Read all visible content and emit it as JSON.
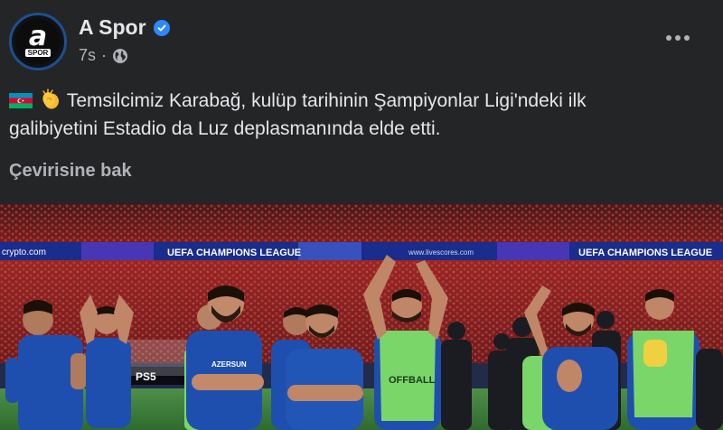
{
  "post": {
    "page_name": "A Spor",
    "timestamp": "7s",
    "separator": "·",
    "avatar": {
      "letter": "a",
      "sub": "SPOR"
    },
    "text_line1": "Temsilcimiz Karabağ, kulüp tarihinin Şampiyonlar Ligi'ndeki ilk",
    "text_line2": "galibiyetini Estadio da Luz deplasmanında elde etti.",
    "see_translation": "Çevirisine bak",
    "icons": [
      "verified-icon",
      "globe-icon",
      "more-icon",
      "azerbaijan-flag-icon",
      "clapping-hands-icon"
    ]
  },
  "photo": {
    "banner_left": "crypto.com",
    "banner_ucl_1": "UEFA CHAMPIONS LEAGUE",
    "banner_mid": "www.livescores.com",
    "banner_ucl_2": "UEFA CHAMPIONS LEAGUE",
    "ads_board": "PS5",
    "shirt_sponsor": "AZERSUN",
    "bib_text": "OFFBALL",
    "colors": {
      "kit": "#1f4fae",
      "bib": "#7bd66a",
      "stands": "#8f1d1d",
      "pitch": "#3d7f3b"
    }
  }
}
